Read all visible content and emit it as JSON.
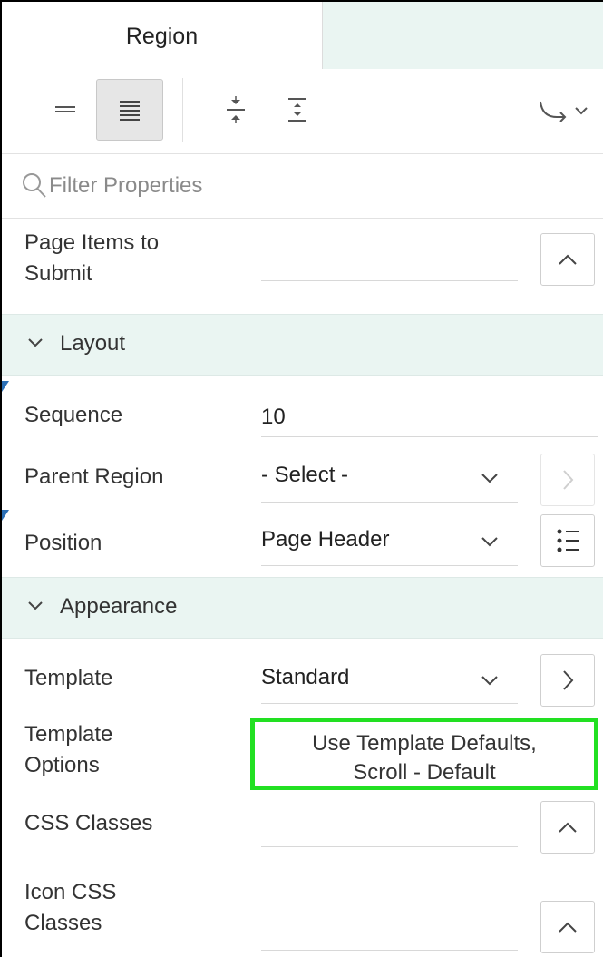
{
  "tabs": {
    "active": "Region"
  },
  "toolbar": {
    "buttons": [
      {
        "name": "show-common-button",
        "icon": "collapsed-lines-icon",
        "pressed": false
      },
      {
        "name": "show-all-button",
        "icon": "all-lines-icon",
        "pressed": true
      },
      {
        "name": "collapse-all-button",
        "icon": "collapse-icon",
        "pressed": false
      },
      {
        "name": "expand-all-button",
        "icon": "expand-icon",
        "pressed": false
      },
      {
        "name": "go-to-group-button",
        "icon": "go-to-arrow-icon",
        "pressed": false
      }
    ]
  },
  "filter": {
    "placeholder": "Filter Properties"
  },
  "rows": {
    "page_items": {
      "label_line1": "Page Items to",
      "label_line2": "Submit",
      "value": ""
    },
    "layout": {
      "title": "Layout"
    },
    "sequence": {
      "label": "Sequence",
      "value": "10"
    },
    "parent_region": {
      "label": "Parent Region",
      "value": "- Select -"
    },
    "position": {
      "label": "Position",
      "value": "Page Header"
    },
    "appearance": {
      "title": "Appearance"
    },
    "template": {
      "label": "Template",
      "value": "Standard"
    },
    "template_options": {
      "label_line1": "Template",
      "label_line2": "Options",
      "value_line1": "Use Template Defaults,",
      "value_line2": "Scroll - Default"
    },
    "css_classes": {
      "label": "CSS Classes",
      "value": ""
    },
    "icon_css": {
      "label_line1": "Icon CSS",
      "label_line2": "Classes",
      "value": ""
    }
  },
  "colors": {
    "section_bg": "#eaf5f2",
    "highlight": "#22e022",
    "marker": "#2b6fb5"
  }
}
